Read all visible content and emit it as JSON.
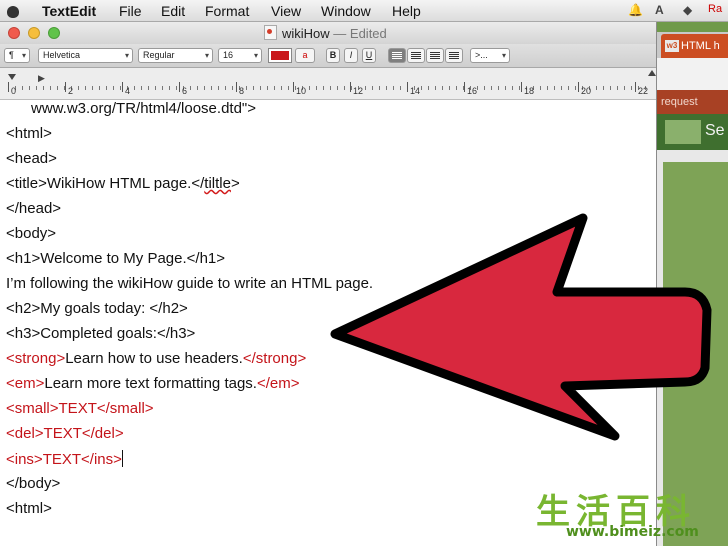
{
  "menubar": {
    "app": "TextEdit",
    "items": [
      "File",
      "Edit",
      "Format",
      "View",
      "Window",
      "Help"
    ],
    "right_text": "Ra"
  },
  "window": {
    "title": "wikiHow",
    "title_suffix": "— Edited"
  },
  "toolbar": {
    "paragraph_style": "¶",
    "font": "Helvetica",
    "typeface": "Regular",
    "size": "16",
    "text_color": "#c9171b",
    "bold": "B",
    "italic": "I",
    "underline": "U",
    "list": ">..."
  },
  "ruler": {
    "numbers": [
      "0",
      "2",
      "4",
      "6",
      "8",
      "10",
      "12",
      "14",
      "16",
      "18",
      "20",
      "22"
    ]
  },
  "document": {
    "lines": [
      {
        "text": "      www.w3.org/TR/html4/loose.dtd\">",
        "style": "normal"
      },
      {
        "text": "<html>",
        "style": "normal"
      },
      {
        "text": "<head>",
        "style": "normal"
      },
      {
        "text": "<title>WikiHow HTML page.</",
        "suffix": "tiltle",
        "tail": ">",
        "style": "spell"
      },
      {
        "text": "</head>",
        "style": "normal"
      },
      {
        "text": "<body>",
        "style": "normal"
      },
      {
        "text": "<h1>Welcome to My Page.</h1>",
        "style": "normal"
      },
      {
        "text": "I’m following the wikiHow guide to write an HTML page.",
        "style": "normal"
      },
      {
        "text": "<h2>My goals today: </h2>",
        "style": "normal"
      },
      {
        "text": "<h3>Completed goals:</h3>",
        "style": "normal"
      },
      {
        "open": "<strong>",
        "inner": "Learn how to use headers.",
        "close": "</strong>",
        "style": "tagged"
      },
      {
        "open": "<em>",
        "inner": "Learn more text formatting tags.",
        "close": "</em>",
        "style": "tagged"
      },
      {
        "text": "<small>TEXT</small>",
        "style": "red"
      },
      {
        "text": "<del>TEXT</del>",
        "style": "red"
      },
      {
        "text": "<ins>TEXT</ins>",
        "style": "red-caret"
      },
      {
        "text": "</body>",
        "style": "normal"
      },
      {
        "text": "<html>",
        "style": "normal"
      }
    ]
  },
  "background_browser": {
    "tab_label": "HTML h",
    "tab_badge": "w3",
    "request_text": "request",
    "nav_text": "Se"
  },
  "watermark": {
    "chinese": "生活百科",
    "url": "www.bimeiz.com"
  },
  "colors": {
    "tag_red": "#c4141a",
    "arrow_red": "#d8283e"
  }
}
